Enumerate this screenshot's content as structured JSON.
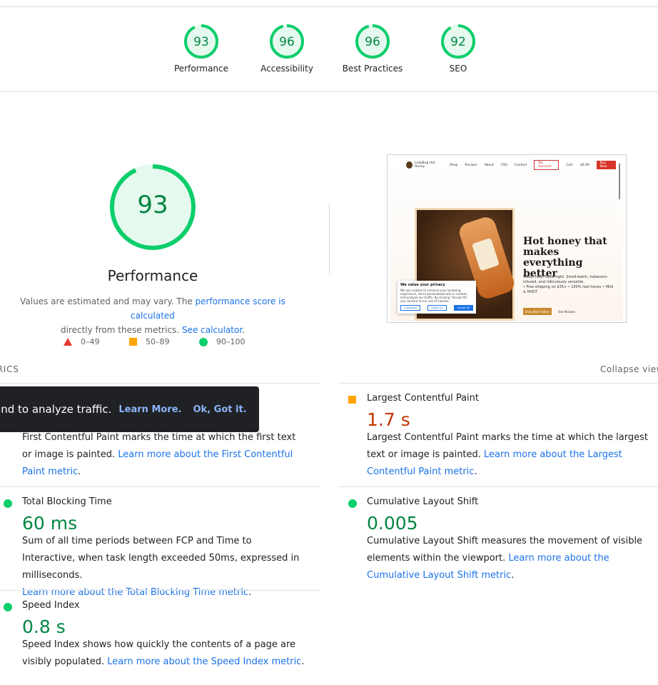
{
  "summary_gauges": [
    {
      "score": "93",
      "label": "Performance"
    },
    {
      "score": "96",
      "label": "Accessibility"
    },
    {
      "score": "96",
      "label": "Best Practices"
    },
    {
      "score": "92",
      "label": "SEO"
    }
  ],
  "main_gauge": {
    "score": "93",
    "title": "Performance"
  },
  "note": {
    "part1": "Values are estimated and may vary. The ",
    "link1": "performance score is calculated",
    "part2": "directly from these metrics. ",
    "link2": "See calculator",
    "part3": "."
  },
  "legend": {
    "fail": "0–49",
    "average": "50–89",
    "pass": "90–100"
  },
  "colors": {
    "pass": "#0cce6b",
    "average": "#ffa400",
    "fail": "#e53935",
    "pass_text": "#018642",
    "average_text": "#c33300",
    "link": "#1a73e8"
  },
  "thumbnail": {
    "brand": "LadyBug Hot Honey",
    "nav": [
      "Shop",
      "Recipes",
      "About",
      "FAQ",
      "Contact"
    ],
    "account": "My Account",
    "cart": "Cart",
    "cart_amount": "$0.00",
    "buy": "Buy Now",
    "headline": "Hot honey that makes everything better",
    "subline": "Sweet heat, done right. Small-batch, habanero-infused, and ridiculously versatile.",
    "bullets": "• Free shipping on $35+  • 100% real honey  • Mild & HHOT",
    "btn_primary": "Shop Best Sellers",
    "btn_secondary": "See Recipes",
    "privacy_title": "We value your privacy",
    "privacy_text": "We use cookies to enhance your browsing experience, serve personalized ads or content, and analyze our traffic. By clicking \"Accept All\", you consent to our use of cookies.",
    "privacy_buttons": [
      "Customize",
      "Reject All",
      "Accept All"
    ]
  },
  "metrics_header": {
    "left": "METRICS",
    "right": "Collapse view"
  },
  "toast": {
    "text": "and to analyze traffic.",
    "learn": "Learn More.",
    "ok": "Ok, Got it."
  },
  "metrics": {
    "fcp": {
      "desc": "First Contentful Paint marks the time at which the first text or image is painted. ",
      "link": "Learn more about the First Contentful Paint metric",
      "end": "."
    },
    "lcp": {
      "title": "Largest Contentful Paint",
      "value": "1.7 s",
      "desc": "Largest Contentful Paint marks the time at which the largest text or image is painted. ",
      "link": "Learn more about the Largest Contentful Paint metric",
      "end": "."
    },
    "tbt": {
      "title": "Total Blocking Time",
      "value": "60 ms",
      "desc": "Sum of all time periods between FCP and Time to Interactive, when task length exceeded 50ms, expressed in milliseconds.",
      "link": "Learn more about the Total Blocking Time metric",
      "end": "."
    },
    "cls": {
      "title": "Cumulative Layout Shift",
      "value": "0.005",
      "desc": "Cumulative Layout Shift measures the movement of visible elements within the viewport. ",
      "link": "Learn more about the Cumulative Layout Shift metric",
      "end": "."
    },
    "si": {
      "title": "Speed Index",
      "value": "0.8 s",
      "desc": "Speed Index shows how quickly the contents of a page are visibly populated. ",
      "link": "Learn more about the Speed Index metric",
      "end": "."
    }
  }
}
